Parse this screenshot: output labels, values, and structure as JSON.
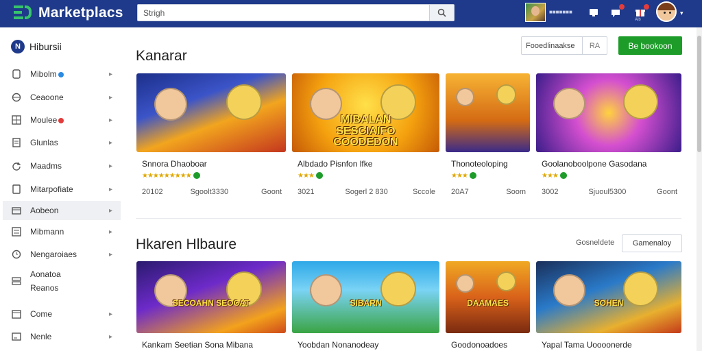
{
  "app": {
    "brand": "Marketplacs"
  },
  "search": {
    "value": "Strigh",
    "placeholder": ""
  },
  "topbar": {
    "user_caption": "■■■■■■■",
    "icon_caption": "Alb",
    "icons": [
      "monitor-icon",
      "chat-icon",
      "gift-icon"
    ],
    "accent": "#1f3a8a"
  },
  "sidebar": {
    "header": "Hibursii",
    "items": [
      {
        "label": "Mibolm",
        "icon": "phone-icon",
        "dot": "#2b8ae2",
        "chevron": true
      },
      {
        "label": "Ceaoone",
        "icon": "globe-icon",
        "chevron": true
      },
      {
        "label": "Moulee",
        "icon": "grid-icon",
        "dot": "#e23c3c",
        "chevron": true
      },
      {
        "label": "Glunlas",
        "icon": "document-icon",
        "chevron": true
      },
      {
        "label": "Maadms",
        "icon": "refresh-icon",
        "chevron": true
      },
      {
        "label": "Mitarpofiate",
        "icon": "tablet-icon",
        "chevron": true
      },
      {
        "label": "Aobeon",
        "icon": "box-icon",
        "chevron": true,
        "active": true
      },
      {
        "label": "Mibmann",
        "icon": "list-icon",
        "chevron": true
      },
      {
        "label": "Nengaroiaes",
        "icon": "clock-icon",
        "chevron": true
      },
      {
        "label": "Aonatoa\nReanos",
        "icon": "stack-icon",
        "chevron": false
      },
      {
        "label": "Come",
        "icon": "calendar-icon",
        "chevron": true
      },
      {
        "label": "Nenle",
        "icon": "card-icon",
        "chevron": true
      }
    ]
  },
  "section1": {
    "title": "Kanarar",
    "sort_label": "Fooedlinaakse",
    "sort_value": "RA",
    "cta": "Be bookoon",
    "cards": [
      {
        "title": "Snnora Dhaoboar",
        "rating": "★★★★★★★★★",
        "meta_left": "20102",
        "meta_mid": "Sgoolt3330",
        "meta_right": "Goont",
        "img": "img1"
      },
      {
        "title": "Albdado Pisnfon lfke",
        "rating": "★★★",
        "meta_left": "3021",
        "meta_mid": "Sogerl 2 830",
        "meta_right": "Sccole",
        "img": "img2"
      },
      {
        "title": "Thonoteoloping",
        "rating": "★★★",
        "meta_left": "20A7",
        "meta_mid": "",
        "meta_right": "Soom",
        "img": "img3"
      },
      {
        "title": "Goolanoboolpone Gasodana",
        "rating": "★★★",
        "meta_left": "3002",
        "meta_mid": "Sjuoul5300",
        "meta_right": "Goont",
        "img": "img4"
      }
    ],
    "banner_text": [
      "MIBALAN",
      "SESCIAIFO",
      "COODEDON"
    ]
  },
  "section2": {
    "title": "Hkaren Hlbaure",
    "filter_label": "Gosneldete",
    "category_button": "Gamenaloy",
    "cards": [
      {
        "title": "Kankam Seetian Sona Mibana",
        "img": "img5"
      },
      {
        "title": "Yoobdan Nonanodeay",
        "img": "img6"
      },
      {
        "title": "Goodonoadoes",
        "img": "img7"
      },
      {
        "title": "Yapal Tama Uoooonerde",
        "img": "img8"
      }
    ],
    "banner_texts": [
      "SECOAHN SEOCAT",
      "SIBARN",
      "DAAMAES",
      "SOHEN"
    ]
  }
}
